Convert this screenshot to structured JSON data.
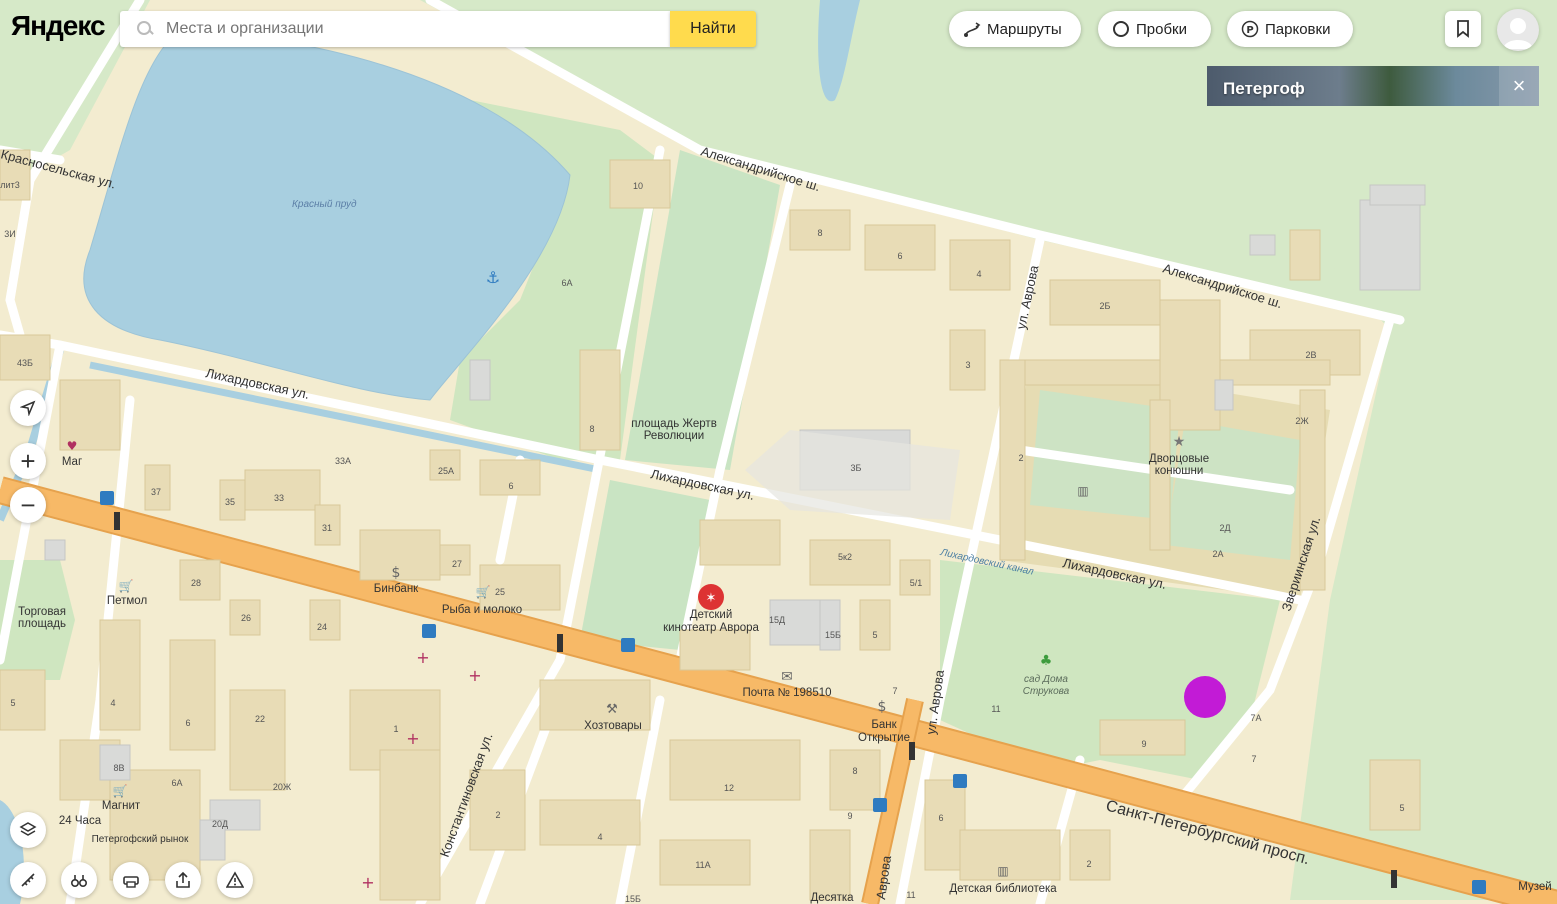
{
  "app": {
    "logo": "Яндекс"
  },
  "search": {
    "placeholder": "Места и организации",
    "button_label": "Найти"
  },
  "top_controls": {
    "routes_label": "Маршруты",
    "traffic_label": "Пробки",
    "parking_label": "Парковки"
  },
  "banner": {
    "title": "Петергоф"
  },
  "map": {
    "streets": {
      "aleksandriyskoe_1": "Александрийское ш.",
      "aleksandriyskoe_2": "Александрийское ш.",
      "likhardovskaya_1": "Лихардовская ул.",
      "likhardovskaya_2": "Лихардовская ул.",
      "likhardovskaya_3": "Лихардовская ул.",
      "likhardovskaya_kanal": "Лихардовский канал",
      "avrova_1": "ул. Аврова",
      "avrova_2": "ул. Аврова",
      "avrova_3": "Аврова",
      "zverinskaya": "Звериинская ул.",
      "konstantinovskaya": "Константиновская ул.",
      "spb_prosp": "Санкт-Петербургский просп.",
      "krasnoselskaya": "Красносельская ул."
    },
    "water": {
      "krasny_prud": "Красный пруд"
    },
    "pois": {
      "ploshad": "площадь Жертв Революции",
      "ploshad_l1": "площадь Жертв",
      "ploshad_l2": "Революции",
      "konyushni_l1": "Дворцовые",
      "konyushni_l2": "конюшни",
      "kinoteatr_l1": "Детский",
      "kinoteatr_l2": "кинотеатр Аврора",
      "pochta": "Почта № 198510",
      "bank_l1": "Банк",
      "bank_l2": "Открытие",
      "binbank": "Бинбанк",
      "ryba": "Рыба и молоко",
      "petmol": "Петмол",
      "torgovaya_l1": "Торговая",
      "torgovaya_l2": "площадь",
      "hoztovary": "Хозтовары",
      "magnit": "Магнит",
      "chasa24": "24 Часа",
      "petergofsky_rynok": "Петергофский рынок",
      "sad_l1": "сад Дома",
      "sad_l2": "Струкова",
      "detskaya_biblioteka": "Детская библиотека",
      "desyatka": "Десятка",
      "muzei": "Музей",
      "mag": "Маг"
    },
    "buildings": [
      "10",
      "8",
      "6",
      "4",
      "3",
      "3Б",
      "2Б",
      "2В",
      "2Ж",
      "2Д",
      "2А",
      "2",
      "6А",
      "33А",
      "25А",
      "6",
      "37",
      "35",
      "33",
      "31",
      "27",
      "25",
      "28",
      "26",
      "24",
      "22",
      "4",
      "6",
      "1",
      "8В",
      "6А",
      "20Ж",
      "20Д",
      "2",
      "4",
      "12",
      "11А",
      "8",
      "9",
      "6",
      "2",
      "9",
      "11",
      "7",
      "7А",
      "5",
      "5к2",
      "5/1",
      "15Д",
      "15Б",
      "5",
      "7",
      "43Б",
      "5",
      "3И",
      "лит3",
      "11",
      "15Б",
      "8"
    ]
  },
  "colors": {
    "road_major": "#f7b967",
    "road_minor": "#ffffff",
    "water": "#a8cfe0",
    "park": "#cfe6c0",
    "block": "#f3ecd0",
    "building": "#e8dcb6",
    "marker": "#c21bd6",
    "search_button": "#ffdb4d"
  }
}
